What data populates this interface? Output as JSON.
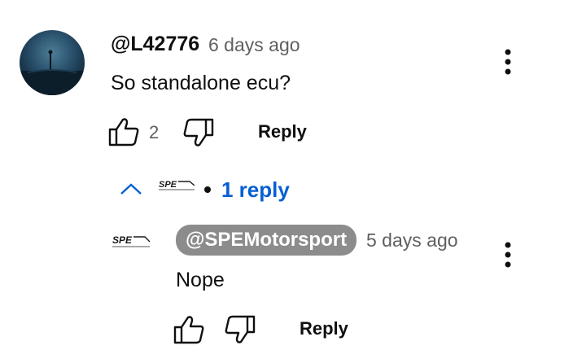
{
  "comment": {
    "author": "@L42776",
    "time": "6 days ago",
    "text": "So standalone ecu?",
    "like_count": "2",
    "reply_label": "Reply"
  },
  "replies_toggle": {
    "label": "1 reply"
  },
  "reply": {
    "author": "@SPEMotorsport",
    "time": "5 days ago",
    "text": "Nope",
    "reply_label": "Reply"
  },
  "icons": {
    "like": "thumbs-up-icon",
    "dislike": "thumbs-down-icon",
    "menu": "more-vertical-icon",
    "collapse": "chevron-up-icon"
  },
  "colors": {
    "link_blue": "#065fd4",
    "muted": "#606060",
    "pill": "#8c8c8c"
  }
}
